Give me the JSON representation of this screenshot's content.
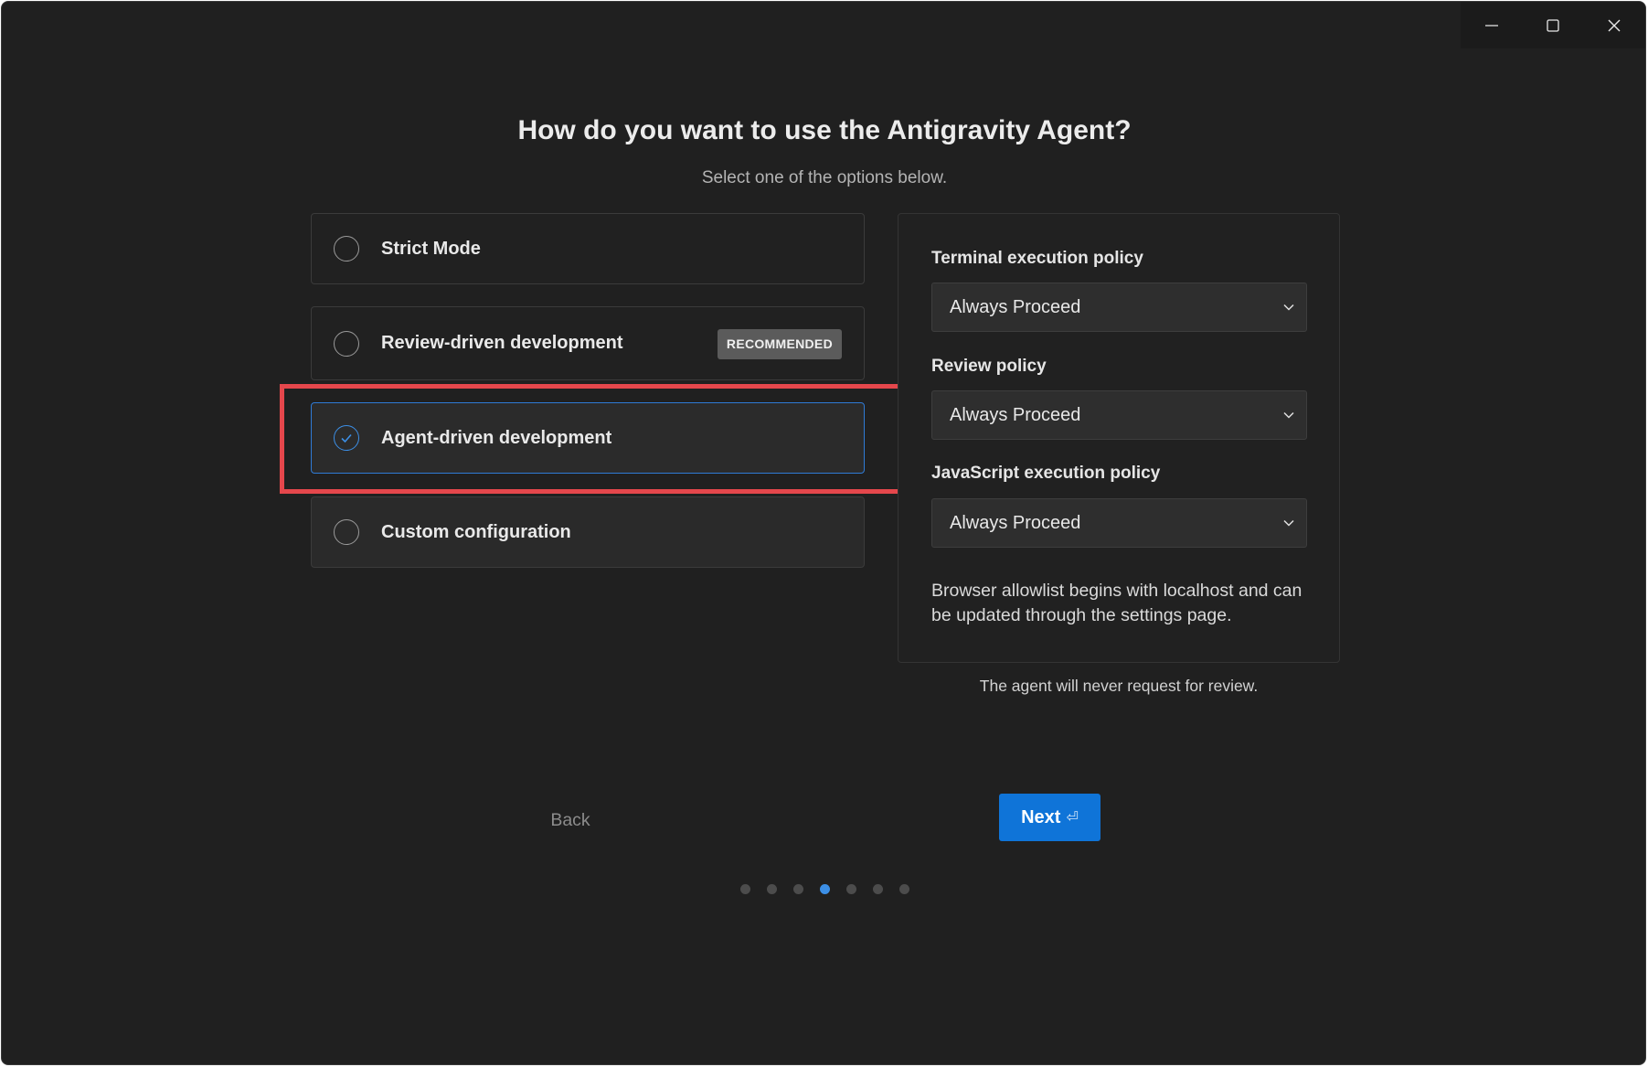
{
  "window": {
    "controls": {
      "minimize": "minimize-icon",
      "maximize": "maximize-icon",
      "close": "close-icon"
    }
  },
  "header": {
    "title": "How do you want to use the Antigravity Agent?",
    "subtitle": "Select one of the options below."
  },
  "options": [
    {
      "label": "Strict Mode",
      "selected": false
    },
    {
      "label": "Review-driven development",
      "badge": "RECOMMENDED",
      "selected": false
    },
    {
      "label": "Agent-driven development",
      "selected": true
    },
    {
      "label": "Custom configuration",
      "selected": false
    }
  ],
  "settings": {
    "terminal_label": "Terminal execution policy",
    "terminal_value": "Always Proceed",
    "review_label": "Review policy",
    "review_value": "Always Proceed",
    "js_label": "JavaScript execution policy",
    "js_value": "Always Proceed",
    "note": "Browser allowlist begins with localhost and can be updated through the settings page."
  },
  "footnote": "The agent will never request for review.",
  "nav": {
    "back_label": "Back",
    "next_label": "Next",
    "next_hint": "⏎"
  },
  "progress": {
    "total_steps": 7,
    "current_step": 4
  },
  "colors": {
    "accent": "#0f74d8",
    "selection_border": "#2f7bd6",
    "highlight": "#e5474c",
    "background": "#202020"
  }
}
